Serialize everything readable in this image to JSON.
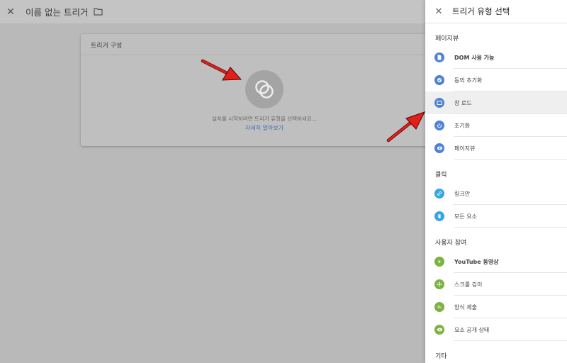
{
  "editor": {
    "title": "이름 없는 트리거",
    "card_title": "트리거 구성",
    "hint": "설치를 시작하려면 트리거 유형을 선택하세요...",
    "learn_more": "자세히 알아보기"
  },
  "panel": {
    "title": "트리거 유형 선택",
    "sections": [
      {
        "label": "페이지뷰",
        "items": [
          {
            "label": "DOM 사용 가능",
            "icon": "document-icon",
            "color": "#4e82d6"
          },
          {
            "label": "동의 초기화",
            "icon": "consent-icon",
            "color": "#4e82d6"
          },
          {
            "label": "창 로드",
            "icon": "window-icon",
            "color": "#4e82d6"
          },
          {
            "label": "초기화",
            "icon": "power-icon",
            "color": "#4e82d6"
          },
          {
            "label": "페이지뷰",
            "icon": "eye-icon",
            "color": "#4e82d6"
          }
        ]
      },
      {
        "label": "클릭",
        "items": [
          {
            "label": "링크만",
            "icon": "link-icon",
            "color": "#35a8df"
          },
          {
            "label": "모든 요소",
            "icon": "mouse-icon",
            "color": "#35a8df"
          }
        ]
      },
      {
        "label": "사용자 참여",
        "items": [
          {
            "label": "YouTube 동영상",
            "icon": "play-icon",
            "color": "#7cb342"
          },
          {
            "label": "스크롤 깊이",
            "icon": "move-icon",
            "color": "#7cb342"
          },
          {
            "label": "양식 제출",
            "icon": "form-icon",
            "color": "#7cb342"
          },
          {
            "label": "요소 공개 상태",
            "icon": "eye-icon",
            "color": "#7cb342"
          }
        ]
      },
      {
        "label": "기타",
        "items": []
      }
    ]
  },
  "colors": {
    "overlay_bg": "#b9b9b9",
    "accent_blue": "#4e82d6",
    "click_cyan": "#35a8df",
    "engagement_green": "#7cb342",
    "arrow_red": "#e0201a"
  }
}
